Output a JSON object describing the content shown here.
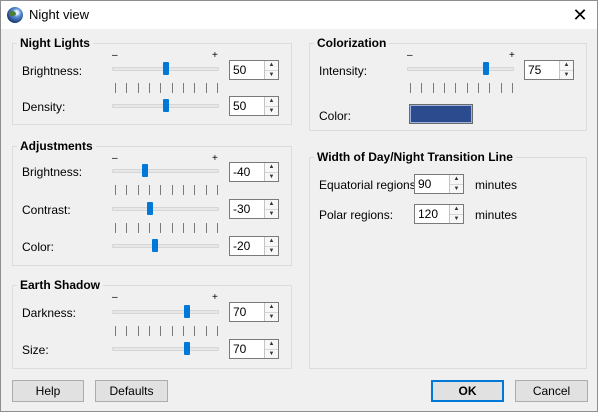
{
  "window": {
    "title": "Night view",
    "close_glyph": "✕"
  },
  "slider_signs": {
    "minus": "–",
    "plus": "+"
  },
  "night_lights": {
    "title": "Night Lights",
    "brightness": {
      "label": "Brightness:",
      "value": "50"
    },
    "density": {
      "label": "Density:",
      "value": "50"
    }
  },
  "adjustments": {
    "title": "Adjustments",
    "brightness": {
      "label": "Brightness:",
      "value": "-40"
    },
    "contrast": {
      "label": "Contrast:",
      "value": "-30"
    },
    "color": {
      "label": "Color:",
      "value": "-20"
    }
  },
  "earth_shadow": {
    "title": "Earth Shadow",
    "darkness": {
      "label": "Darkness:",
      "value": "70"
    },
    "size": {
      "label": "Size:",
      "value": "70"
    }
  },
  "colorization": {
    "title": "Colorization",
    "intensity": {
      "label": "Intensity:",
      "value": "75"
    },
    "color": {
      "label": "Color:",
      "swatch_hex": "#2c4a8e"
    }
  },
  "transition": {
    "title": "Width of Day/Night Transition Line",
    "equatorial": {
      "label": "Equatorial regions:",
      "value": "90",
      "unit": "minutes"
    },
    "polar": {
      "label": "Polar regions:",
      "value": "120",
      "unit": "minutes"
    }
  },
  "buttons": {
    "help": "Help",
    "defaults": "Defaults",
    "ok": "OK",
    "cancel": "Cancel"
  },
  "colors": {
    "accent": "#0078d7"
  }
}
